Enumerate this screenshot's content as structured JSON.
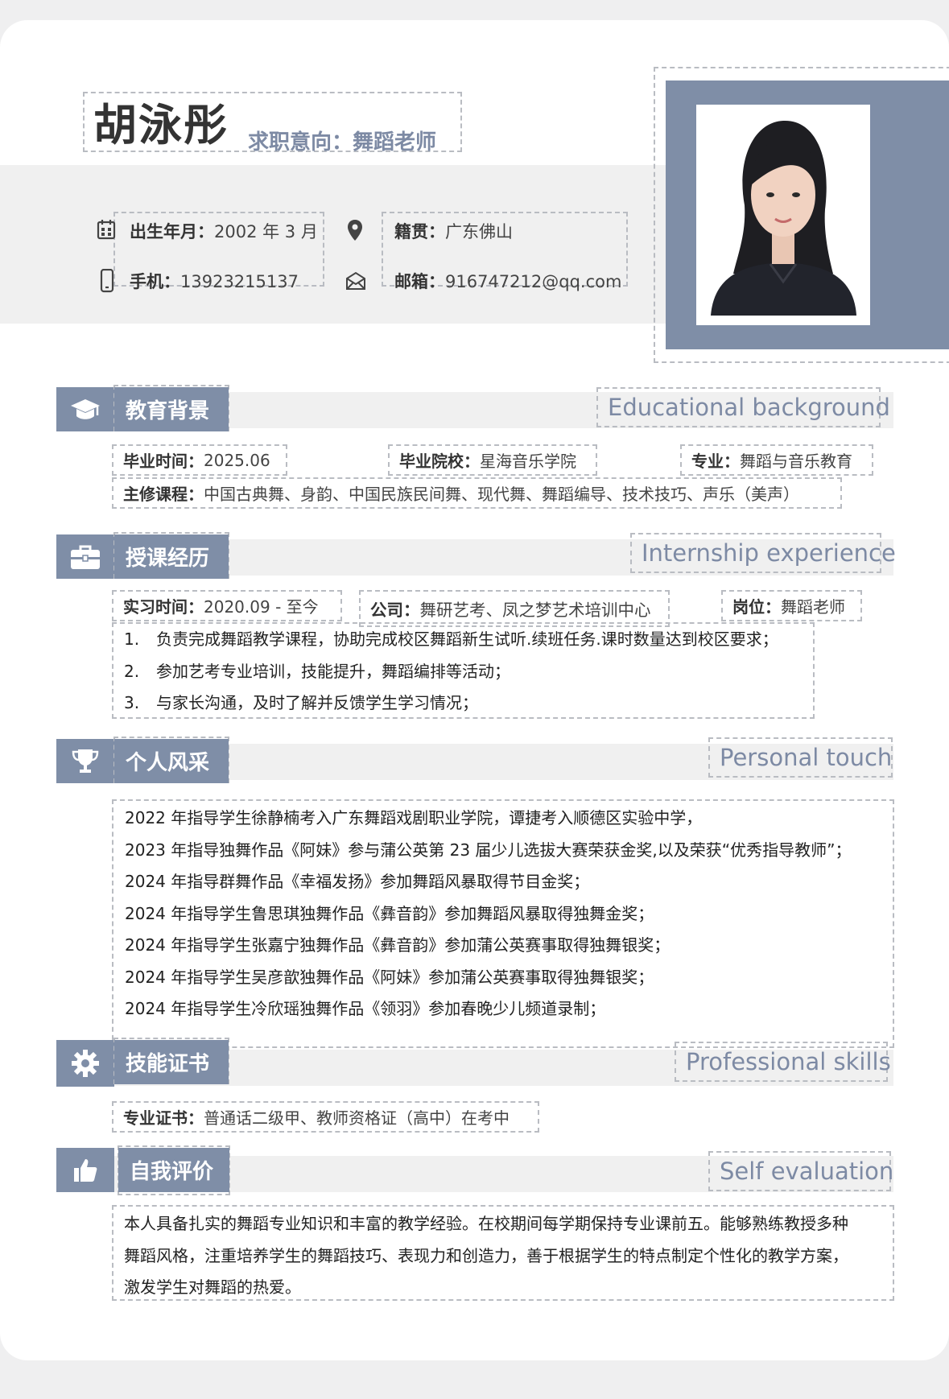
{
  "header": {
    "name": "胡泳彤",
    "intent_label": "求职意向：",
    "intent_value": "舞蹈老师",
    "info": {
      "birth_label": "出生年月：",
      "birth_value": "2002 年 3 月",
      "native_label": "籍贯：",
      "native_value": "广东佛山",
      "phone_label": "手机：",
      "phone_value": "13923215137",
      "email_label": "邮箱：",
      "email_value": "916747212@qq.com"
    }
  },
  "education": {
    "title": "教育背景",
    "title_en": "Educational background",
    "grad_label": "毕业时间：",
    "grad_value": "2025.06",
    "school_label": "毕业院校：",
    "school_value": "星海音乐学院",
    "major_label": "专业：",
    "major_value": "舞蹈与音乐教育",
    "courses_label": "主修课程：",
    "courses_value": "中国古典舞、身韵、中国民族民间舞、现代舞、舞蹈编导、技术技巧、声乐（美声）"
  },
  "experience": {
    "title": "授课经历",
    "title_en": "Internship experience",
    "time_label": "实习时间：",
    "time_value": "2020.09 - 至今",
    "company_label": "公司：",
    "company_value": "舞研艺考、凤之梦艺术培训中心",
    "post_label": "岗位：",
    "post_value": "舞蹈老师",
    "items": [
      {
        "num": "1.",
        "text": "负责完成舞蹈教学课程，协助完成校区舞蹈新生试听.续班任务.课时数量达到校区要求；"
      },
      {
        "num": "2.",
        "text": "参加艺考专业培训，技能提升，舞蹈编排等活动；"
      },
      {
        "num": "3.",
        "text": "与家长沟通，及时了解并反馈学生学习情况；"
      }
    ]
  },
  "personal": {
    "title": "个人风采",
    "title_en": "Personal touch",
    "items": [
      "2022 年指导学生徐静楠考入广东舞蹈戏剧职业学院，谭捷考入顺德区实验中学，",
      "2023 年指导独舞作品《阿妹》参与蒲公英第 23 届少儿选拔大赛荣获金奖,以及荣获“优秀指导教师”；",
      "2024 年指导群舞作品《幸福发扬》参加舞蹈风暴取得节目金奖；",
      "2024 年指导学生鲁思琪独舞作品《彝音韵》参加舞蹈风暴取得独舞金奖；",
      "2024 年指导学生张嘉宁独舞作品《彝音韵》参加蒲公英赛事取得独舞银奖；",
      "2024 年指导学生吴彦歆独舞作品《阿妹》参加蒲公英赛事取得独舞银奖；",
      "2024 年指导学生冷欣瑶独舞作品《领羽》参加春晚少儿频道录制；"
    ]
  },
  "skills": {
    "title": "技能证书",
    "title_en": "Professional skills",
    "cert_label": "专业证书：",
    "cert_value": "普通话二级甲、教师资格证（高中）在考中"
  },
  "self_eval": {
    "title": "自我评价",
    "title_en": "Self evaluation",
    "lines": [
      "本人具备扎实的舞蹈专业知识和丰富的教学经验。在校期间每学期保持专业课前五。能够熟练教授多种",
      "舞蹈风格，注重培养学生的舞蹈技巧、表现力和创造力，善于根据学生的特点制定个性化的教学方案，",
      "激发学生对舞蹈的热爱。"
    ]
  },
  "colors": {
    "accent": "#7f8ea7",
    "accent_text": "#7d8aa4",
    "strip": "#f0f0f0"
  },
  "icons": [
    "calendar-icon",
    "location-pin-icon",
    "phone-icon",
    "mail-icon",
    "graduation-cap-icon",
    "briefcase-icon",
    "trophy-icon",
    "gear-icon",
    "thumbs-up-icon"
  ]
}
